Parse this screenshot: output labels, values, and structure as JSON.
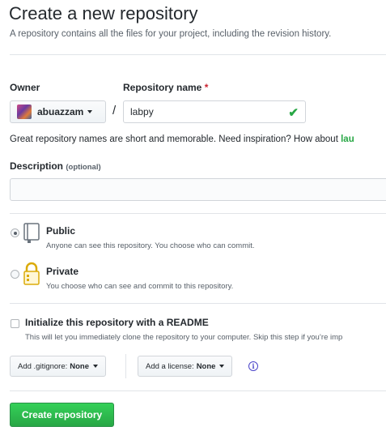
{
  "header": {
    "title": "Create a new repository",
    "subtitle": "A repository contains all the files for your project, including the revision history."
  },
  "owner": {
    "label": "Owner",
    "name": "abuazzam"
  },
  "repo_name": {
    "label": "Repository name",
    "required_mark": "*",
    "value": "labpy",
    "separator": "/"
  },
  "hint": {
    "text": "Great repository names are short and memorable. Need inspiration? How about ",
    "suggestion": "lau"
  },
  "description": {
    "label": "Description",
    "optional": "(optional)",
    "value": ""
  },
  "visibility": {
    "public": {
      "title": "Public",
      "note": "Anyone can see this repository. You choose who can commit.",
      "selected": true
    },
    "private": {
      "title": "Private",
      "note": "You choose who can see and commit to this repository.",
      "selected": false
    }
  },
  "init": {
    "title": "Initialize this repository with a README",
    "note": "This will let you immediately clone the repository to your computer. Skip this step if you’re imp",
    "checked": false
  },
  "gitignore": {
    "prefix": "Add .gitignore:",
    "value": "None"
  },
  "license": {
    "prefix": "Add a license:",
    "value": "None"
  },
  "submit": {
    "label": "Create repository"
  },
  "colors": {
    "accent_green": "#28a745",
    "required_red": "#cb2431",
    "info_blue": "#4b45c9"
  }
}
